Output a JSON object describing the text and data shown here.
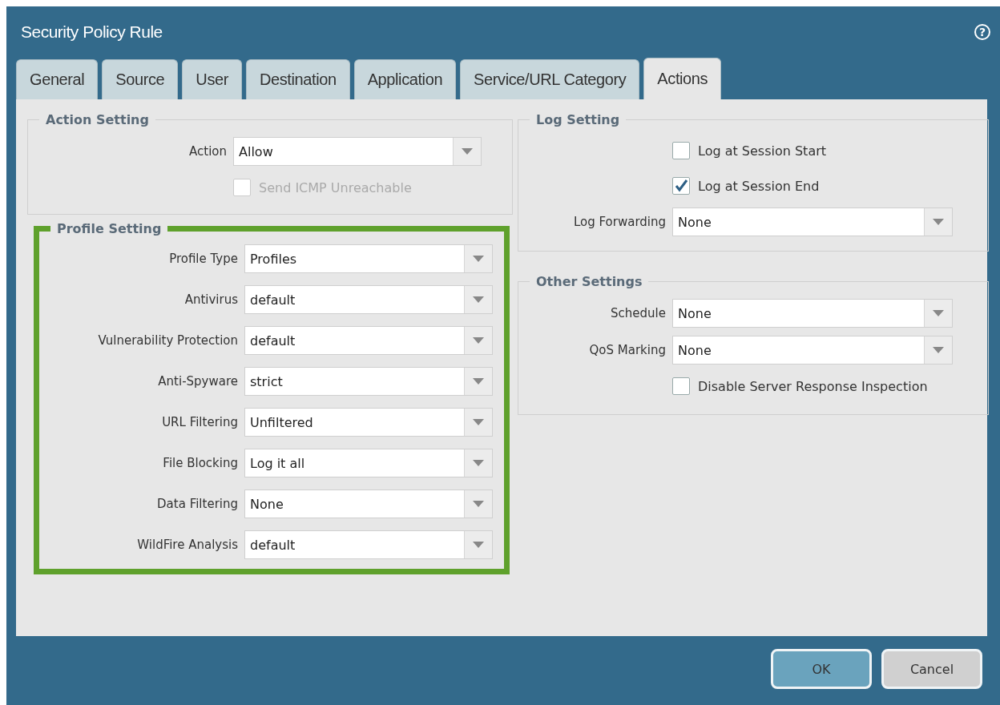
{
  "window": {
    "title": "Security Policy Rule",
    "help_icon": "?"
  },
  "tabs": [
    {
      "label": "General",
      "selected": false
    },
    {
      "label": "Source",
      "selected": false
    },
    {
      "label": "User",
      "selected": false
    },
    {
      "label": "Destination",
      "selected": false
    },
    {
      "label": "Application",
      "selected": false
    },
    {
      "label": "Service/URL Category",
      "selected": false
    },
    {
      "label": "Actions",
      "selected": true
    }
  ],
  "left_column": [
    {
      "title": "Action Setting",
      "highlighted": false,
      "fields": [
        {
          "kind": "select",
          "label": "Action",
          "value": "Allow"
        },
        {
          "kind": "checkbox",
          "label": "Send ICMP Unreachable",
          "checked": false,
          "disabled": true
        }
      ]
    },
    {
      "title": "Profile Setting",
      "highlighted": true,
      "fields": [
        {
          "kind": "select",
          "label": "Profile Type",
          "value": "Profiles"
        },
        {
          "kind": "select",
          "label": "Antivirus",
          "value": "default"
        },
        {
          "kind": "select",
          "label": "Vulnerability Protection",
          "value": "default"
        },
        {
          "kind": "select",
          "label": "Anti-Spyware",
          "value": "strict"
        },
        {
          "kind": "select",
          "label": "URL Filtering",
          "value": "Unfiltered"
        },
        {
          "kind": "select",
          "label": "File Blocking",
          "value": "Log it all"
        },
        {
          "kind": "select",
          "label": "Data Filtering",
          "value": "None"
        },
        {
          "kind": "select",
          "label": "WildFire Analysis",
          "value": "default"
        }
      ]
    }
  ],
  "right_column": [
    {
      "title": "Log Setting",
      "highlighted": false,
      "fields": [
        {
          "kind": "checkbox",
          "label": "Log at Session Start",
          "checked": false,
          "disabled": false
        },
        {
          "kind": "checkbox",
          "label": "Log at Session End",
          "checked": true,
          "disabled": false
        },
        {
          "kind": "select",
          "label": "Log Forwarding",
          "value": "None"
        }
      ]
    },
    {
      "title": "Other Settings",
      "highlighted": false,
      "fields": [
        {
          "kind": "select",
          "label": "Schedule",
          "value": "None"
        },
        {
          "kind": "select",
          "label": "QoS Marking",
          "value": "None"
        },
        {
          "kind": "checkbox",
          "label": "Disable Server Response Inspection",
          "checked": false,
          "disabled": false
        }
      ]
    }
  ],
  "buttons": [
    {
      "label": "OK",
      "kind": "primary"
    },
    {
      "label": "Cancel",
      "kind": "secondary"
    }
  ]
}
